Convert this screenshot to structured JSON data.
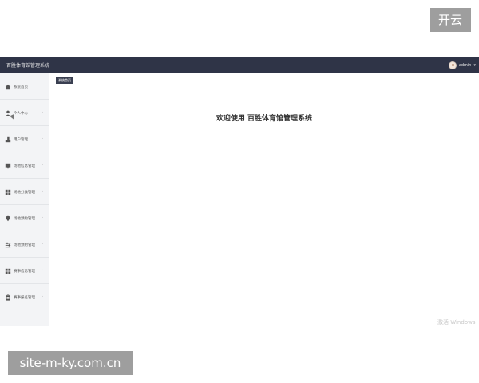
{
  "watermark": {
    "top_right": "开云",
    "bottom_left": "site-m-ky.com.cn",
    "windows": "激活 Windows"
  },
  "header": {
    "title": "百胜体育馆管理系统",
    "user": "admin",
    "user_caret": "▾"
  },
  "tabs": [
    {
      "label": "系统首页"
    }
  ],
  "sidebar": {
    "items": [
      {
        "label": "系统首页",
        "icon": "home-icon",
        "has_arrow": false
      },
      {
        "label": "个人中心",
        "icon": "user-icon",
        "has_arrow": true
      },
      {
        "label": "用户管理",
        "icon": "users-icon",
        "has_arrow": true
      },
      {
        "label": "场地信息管理",
        "icon": "monitor-icon",
        "has_arrow": true
      },
      {
        "label": "场地分类管理",
        "icon": "grid-icon",
        "has_arrow": true
      },
      {
        "label": "场地预约管理",
        "icon": "location-icon",
        "has_arrow": true
      },
      {
        "label": "场地预约管理",
        "icon": "sliders-icon",
        "has_arrow": true
      },
      {
        "label": "赛事信息管理",
        "icon": "grid-icon",
        "has_arrow": true
      },
      {
        "label": "赛事报名管理",
        "icon": "clipboard-icon",
        "has_arrow": true
      }
    ],
    "arrow": "›"
  },
  "main": {
    "welcome": "欢迎使用 百胜体育馆管理系统"
  },
  "colors": {
    "topbar": "#2f3447",
    "sidebar_bg": "#f3f4f6",
    "tab_active": "#3a3f51"
  }
}
